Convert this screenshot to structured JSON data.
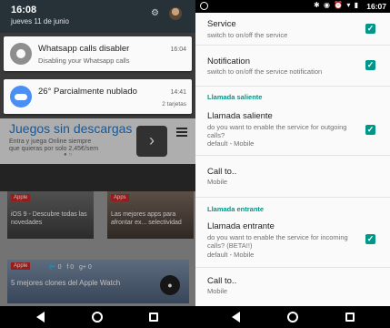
{
  "notification_shade": {
    "time": "16:08",
    "date": "jueves 11 de junio",
    "notifications": [
      {
        "title": "Whatsapp calls disabler",
        "subtitle": "Disabling your Whatsapp calls",
        "time": "16:04",
        "icon": "disabler-icon"
      },
      {
        "title": "26° Parcialmente nublado",
        "subtitle": "",
        "time": "14:41",
        "extra": "2 tarjetas",
        "icon": "weather-cloud-icon"
      }
    ]
  },
  "background_page": {
    "ad_title": "Juegos sin descargas",
    "ad_text": "Entra y juega Online siempre que quieras por solo 2,45€/sem",
    "articles": [
      {
        "tag": "Apple",
        "title": "iOS 9 - Descubre todas las novedades"
      },
      {
        "tag": "Apps",
        "title": "Las mejores apps para afrontar ex... selectividad"
      },
      {
        "tag": "Apple",
        "title": "5 mejores clones del Apple Watch"
      }
    ]
  },
  "settings_screen": {
    "status_time": "16:07",
    "items": [
      {
        "title": "Service",
        "summary": "switch to on/off the service",
        "checked": true
      },
      {
        "title": "Notification",
        "summary": "switch to on/off the service notification",
        "checked": true
      }
    ],
    "sections": [
      {
        "category": "Llamada saliente",
        "items": [
          {
            "title": "Llamada saliente",
            "summary": "do you want to enable the service for outgoing calls?",
            "summary2": "default - Mobile",
            "checked": true
          },
          {
            "title": "Call to..",
            "summary": "Mobile"
          }
        ]
      },
      {
        "category": "Llamada entrante",
        "items": [
          {
            "title": "Llamada entrante",
            "summary": "do you want to enable the service for incoming calls? (BETA!!)",
            "summary2": "default - Mobile",
            "checked": true
          },
          {
            "title": "Call to..",
            "summary": "Mobile"
          }
        ]
      }
    ]
  },
  "colors": {
    "accent": "#009688",
    "shade_header": "#263238"
  }
}
